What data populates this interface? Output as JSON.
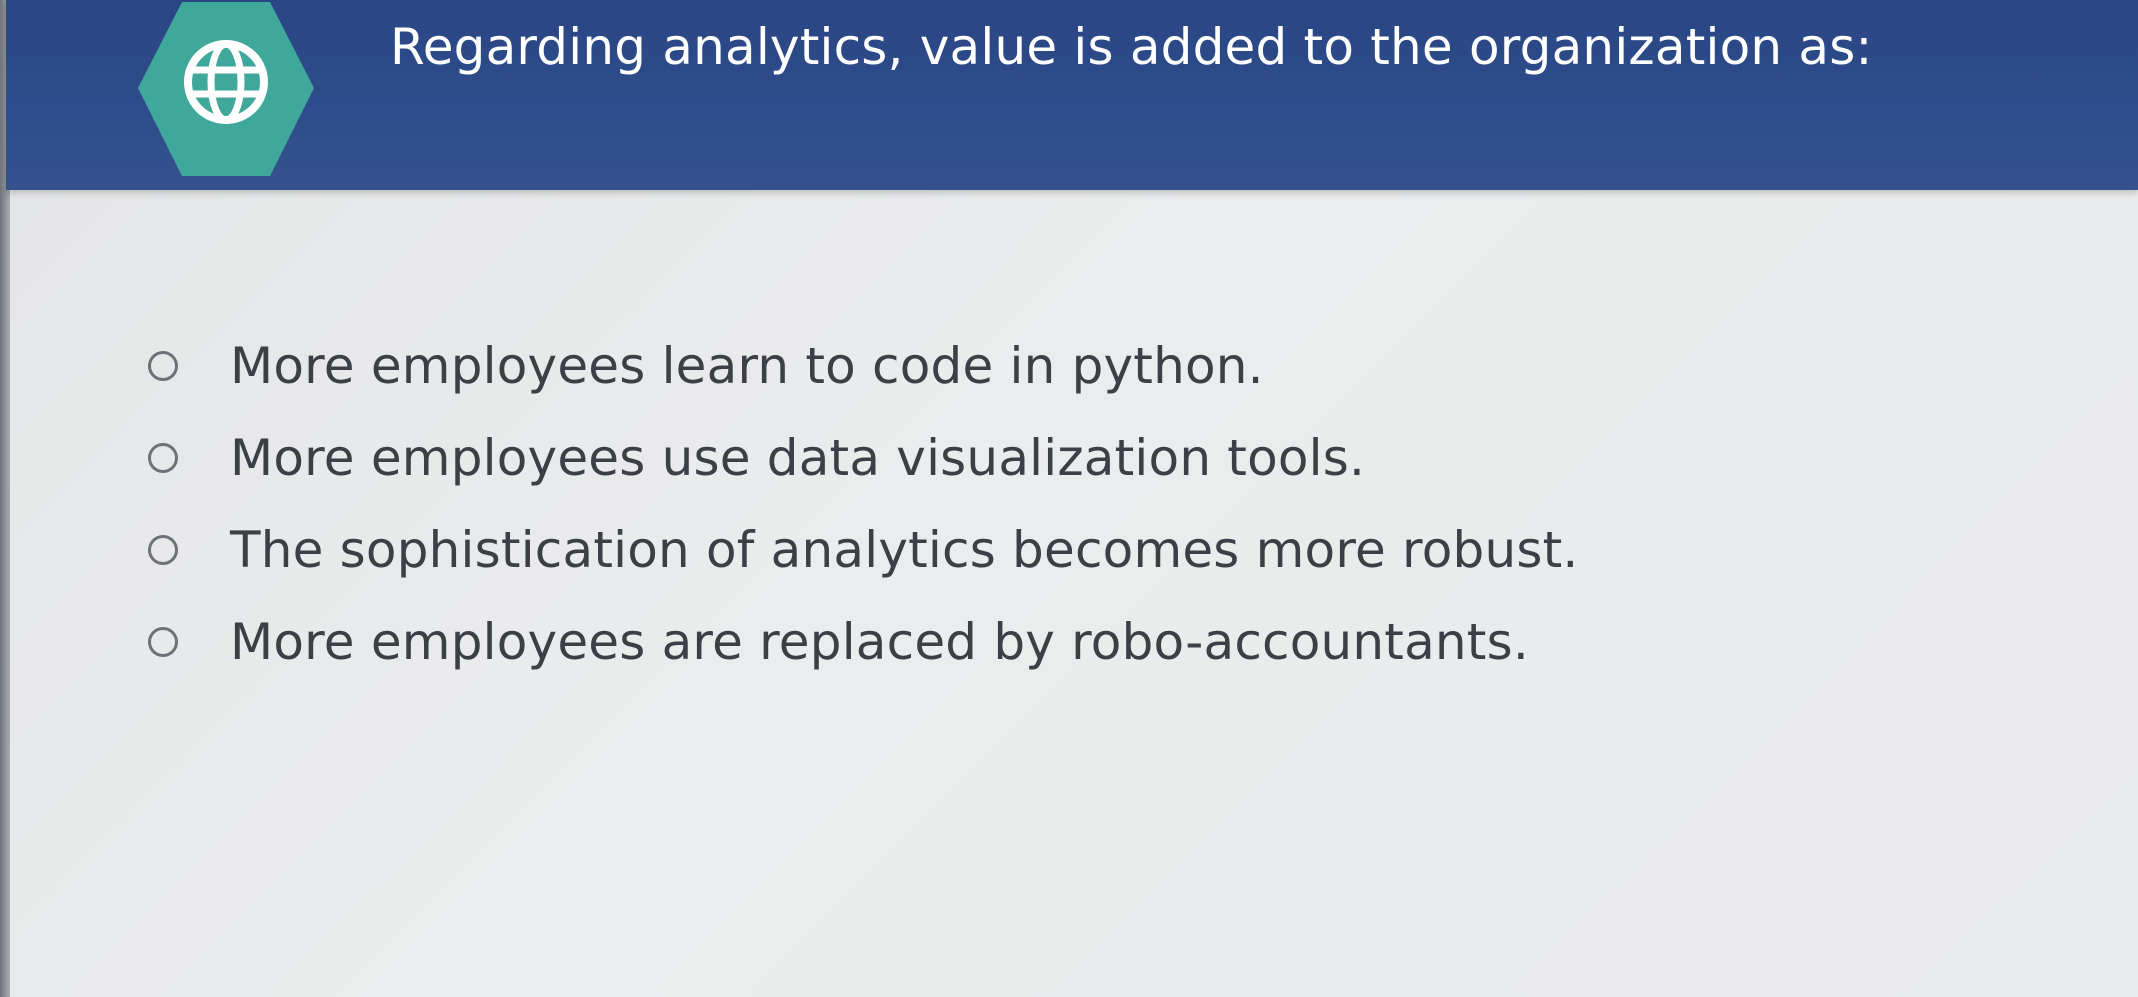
{
  "header": {
    "icon": "globe-icon",
    "question": "Regarding analytics, value is added to the organization as:",
    "colors": {
      "background": "#2f4d8c",
      "badge": "#3fa89a",
      "text": "#ffffff"
    }
  },
  "options": [
    {
      "label": "More employees learn to code in python.",
      "selected": false
    },
    {
      "label": "More employees use data visualization tools.",
      "selected": false
    },
    {
      "label": "The sophistication of analytics becomes more robust.",
      "selected": false
    },
    {
      "label": "More employees are replaced by robo-accountants.",
      "selected": false
    }
  ]
}
